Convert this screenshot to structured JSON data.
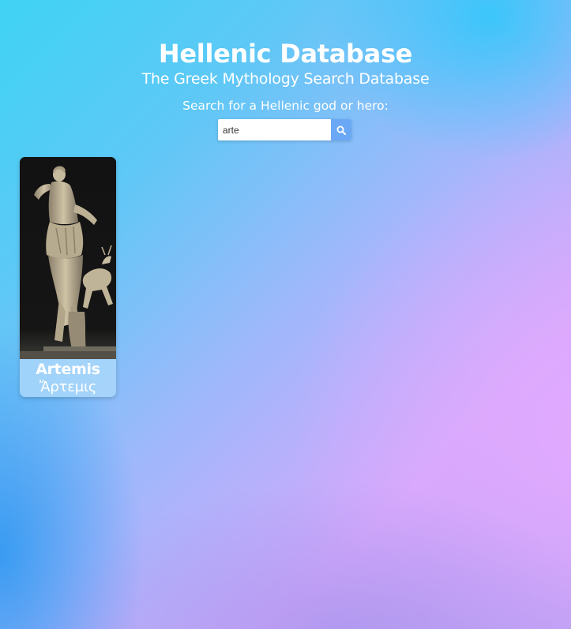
{
  "header": {
    "title": "Hellenic Database",
    "subtitle": "The Greek Mythology Search Database"
  },
  "search": {
    "label": "Search for a Hellenic god or hero:",
    "value": "arte",
    "button_icon": "search-icon"
  },
  "results": [
    {
      "name": "Artemis",
      "greek_name": "Ἄρτεμις",
      "image_icon": "artemis-statue-image"
    }
  ],
  "colors": {
    "search_button": "#6aa8f5",
    "card_caption": "#aad7fa",
    "text": "#ffffff"
  }
}
